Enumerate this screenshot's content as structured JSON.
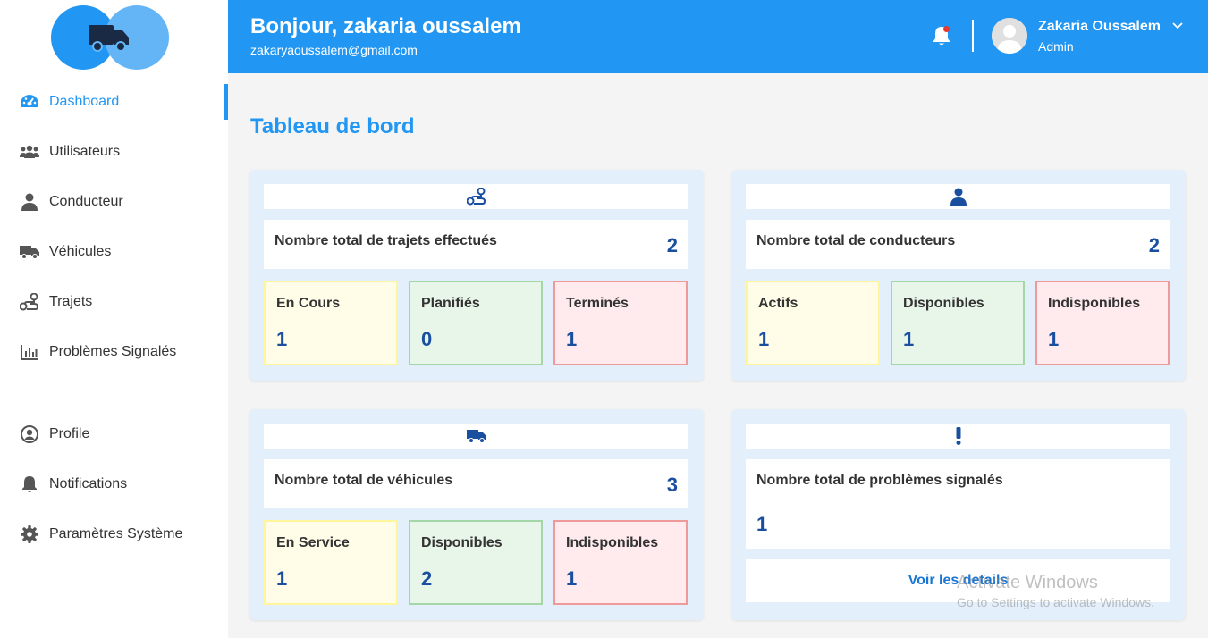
{
  "header": {
    "greeting": "Bonjour, zakaria oussalem",
    "email": "zakaryaoussalem@gmail.com",
    "user_name": "Zakaria Oussalem",
    "user_role": "Admin"
  },
  "sidebar": {
    "items": [
      {
        "label": "Dashboard",
        "icon": "gauge-icon"
      },
      {
        "label": "Utilisateurs",
        "icon": "users-icon"
      },
      {
        "label": "Conducteur",
        "icon": "user-icon"
      },
      {
        "label": "Véhicules",
        "icon": "truck-icon"
      },
      {
        "label": "Trajets",
        "icon": "route-icon"
      },
      {
        "label": "Problèmes Signalés",
        "icon": "chart-icon"
      },
      {
        "label": "Profile",
        "icon": "user-circle-icon"
      },
      {
        "label": "Notifications",
        "icon": "bell-icon"
      },
      {
        "label": "Paramètres Système",
        "icon": "gear-icon"
      }
    ]
  },
  "main": {
    "title": "Tableau de bord",
    "cards": [
      {
        "icon": "route-icon",
        "total_label": "Nombre total de trajets effectués",
        "total_value": "2",
        "subs": [
          {
            "label": "En Cours",
            "value": "1"
          },
          {
            "label": "Planifiés",
            "value": "0"
          },
          {
            "label": "Terminés",
            "value": "1"
          }
        ]
      },
      {
        "icon": "user-icon",
        "total_label": "Nombre total de conducteurs",
        "total_value": "2",
        "subs": [
          {
            "label": "Actifs",
            "value": "1"
          },
          {
            "label": "Disponibles",
            "value": "1"
          },
          {
            "label": "Indisponibles",
            "value": "1"
          }
        ]
      },
      {
        "icon": "truck-icon",
        "total_label": "Nombre total de véhicules",
        "total_value": "3",
        "subs": [
          {
            "label": "En Service",
            "value": "1"
          },
          {
            "label": "Disponibles",
            "value": "2"
          },
          {
            "label": "Indisponibles",
            "value": "1"
          }
        ]
      },
      {
        "icon": "exclamation-icon",
        "total_label": "Nombre total de problèmes signalés",
        "total_value": "1",
        "details_label": "Voir les details"
      }
    ]
  },
  "watermark": {
    "line1": "Activate Windows",
    "line2": "Go to Settings to activate Windows."
  },
  "colors": {
    "primary": "#2196f3",
    "value": "#1a4fa0",
    "yellow_bg": "#fffde7",
    "green_bg": "#e8f5e9",
    "red_bg": "#ffebee"
  }
}
